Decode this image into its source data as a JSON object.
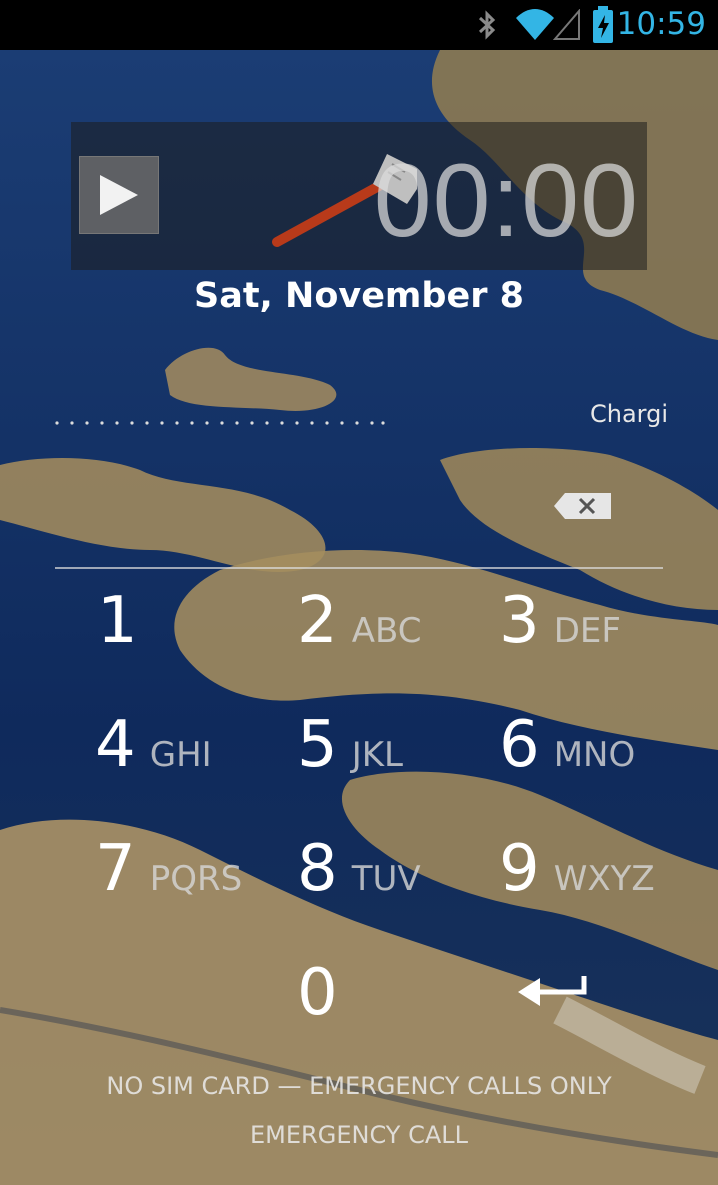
{
  "status_bar": {
    "time": "10:59",
    "icons": [
      "bluetooth-icon",
      "wifi-icon",
      "signal-icon",
      "battery-charging-icon"
    ],
    "accent_color": "#33b5e5"
  },
  "widget": {
    "timer": "00:00",
    "play_icon": "play-icon",
    "decoration_icon": "spatula-icon"
  },
  "date": "Sat, November 8",
  "status_text": "Chargi",
  "keypad": {
    "keys": [
      {
        "num": "1",
        "letters": ""
      },
      {
        "num": "2",
        "letters": "ABC"
      },
      {
        "num": "3",
        "letters": "DEF"
      },
      {
        "num": "4",
        "letters": "GHI"
      },
      {
        "num": "5",
        "letters": "JKL"
      },
      {
        "num": "6",
        "letters": "MNO"
      },
      {
        "num": "7",
        "letters": "PQRS"
      },
      {
        "num": "8",
        "letters": "TUV"
      },
      {
        "num": "9",
        "letters": "WXYZ"
      },
      {
        "num": "0",
        "letters": ""
      }
    ],
    "backspace_icon": "backspace-icon",
    "enter_icon": "enter-icon"
  },
  "footer": {
    "carrier": "NO SIM CARD — EMERGENCY CALLS ONLY",
    "emergency": "EMERGENCY CALL"
  }
}
